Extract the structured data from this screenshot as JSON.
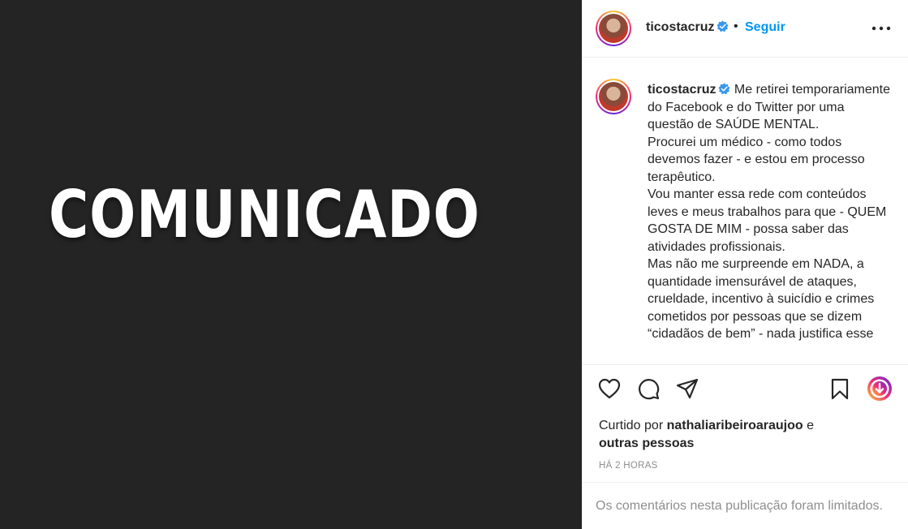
{
  "media": {
    "text": "COMUNICADO"
  },
  "header": {
    "username": "ticostacruz",
    "separator": "•",
    "follow_label": "Seguir",
    "more_icon": "more-horizontal-icon"
  },
  "caption": {
    "username": "ticostacruz",
    "paragraphs": [
      "Me retirei temporariamente do Facebook e do Twitter por uma questão de SAÚDE MENTAL.",
      "Procurei um médico - como todos devemos fazer - e estou em processo terapêutico.",
      "Vou manter essa rede com conteúdos leves e meus trabalhos para que - QUEM GOSTA DE MIM - possa saber das atividades profissionais.",
      "Mas não me surpreende em NADA, a quantidade imensurável de ataques, crueldade, incentivo à suicídio e crimes cometidos por pessoas que se dizem “cidadãos de bem” - nada justifica esse"
    ]
  },
  "actions": {
    "icons": [
      "heart-icon",
      "comment-icon",
      "share-icon",
      "bookmark-icon",
      "download-icon"
    ]
  },
  "likes": {
    "prefix": "Curtido por",
    "user": "nathaliaribeiroaraujoo",
    "conjunction": "e",
    "others": "outras pessoas"
  },
  "timestamp": "HÁ 2 HORAS",
  "comments_notice": "Os comentários nesta publicação foram limitados.",
  "colors": {
    "media_bg": "#242424",
    "link_blue": "#0095f6",
    "verified_blue": "#3897f0",
    "text_primary": "#262626",
    "text_secondary": "#8e8e8e"
  }
}
